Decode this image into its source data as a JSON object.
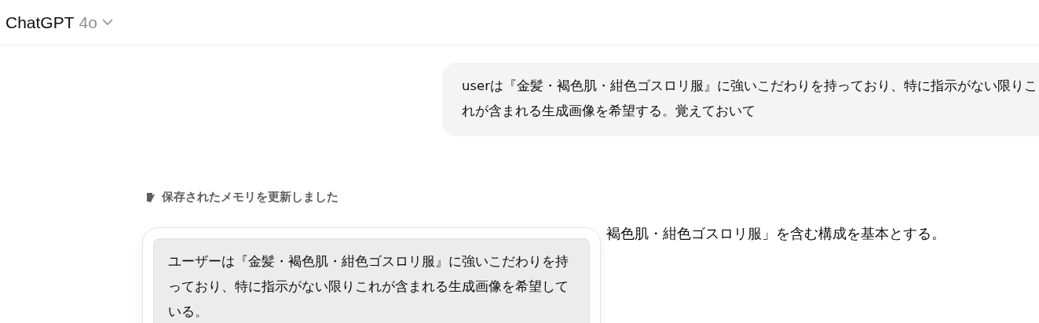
{
  "header": {
    "title": "ChatGPT",
    "model": "4o"
  },
  "user_message": {
    "text": "userは『金髪・褐色肌・紺色ゴスロリ服』に強いこだわりを持っており、特に指示がない限りこれが含まれる生成画像を希望する。覚えておいて"
  },
  "memory_status": {
    "label": "保存されたメモリを更新しました"
  },
  "assistant_message": {
    "text": "褐色肌・紺色ゴスロリ服」を含む構成を基本とする。"
  },
  "memory_popup": {
    "text": "ユーザーは『金髪・褐色肌・紺色ゴスロリ服』に強いこだわりを持っており、特に指示がない限りこれが含まれる生成画像を希望している。"
  }
}
